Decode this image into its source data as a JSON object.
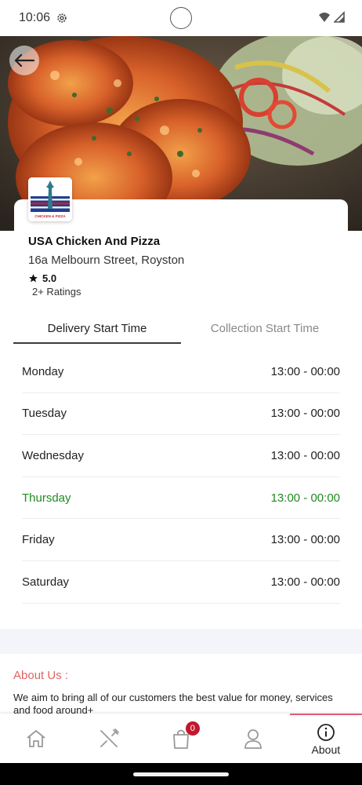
{
  "status_bar": {
    "time": "10:06"
  },
  "restaurant": {
    "name": "USA Chicken And Pizza",
    "address": "16a Melbourn Street, Royston",
    "rating": "5.0",
    "ratings_count": "2+ Ratings",
    "logo_text": "CHICKEN & PIZZA"
  },
  "tabs": [
    {
      "label": "Delivery Start Time",
      "active": true
    },
    {
      "label": "Collection Start Time",
      "active": false
    }
  ],
  "hours": [
    {
      "day": "Monday",
      "time": "13:00 - 00:00"
    },
    {
      "day": "Tuesday",
      "time": "13:00 - 00:00"
    },
    {
      "day": "Wednesday",
      "time": "13:00 - 00:00"
    },
    {
      "day": "Thursday",
      "time": "13:00 - 00:00",
      "highlighted": true
    },
    {
      "day": "Friday",
      "time": "13:00 - 00:00"
    },
    {
      "day": "Saturday",
      "time": "13:00 - 00:00"
    }
  ],
  "about": {
    "title": "About Us :",
    "text": "We aim to bring all of our customers the best value for money, services and food around+"
  },
  "bottom_nav": {
    "items": [
      {
        "icon": "home-icon"
      },
      {
        "icon": "utensils-icon"
      },
      {
        "icon": "shopping-bag-icon",
        "badge": "0"
      },
      {
        "icon": "user-icon"
      },
      {
        "icon": "info-icon",
        "label": "About",
        "active": true
      }
    ]
  },
  "colors": {
    "highlight_day": "#1f8a1f",
    "about_title": "#e06464",
    "active_tab_indicator": "#e55a78",
    "badge": "#c2172e"
  }
}
